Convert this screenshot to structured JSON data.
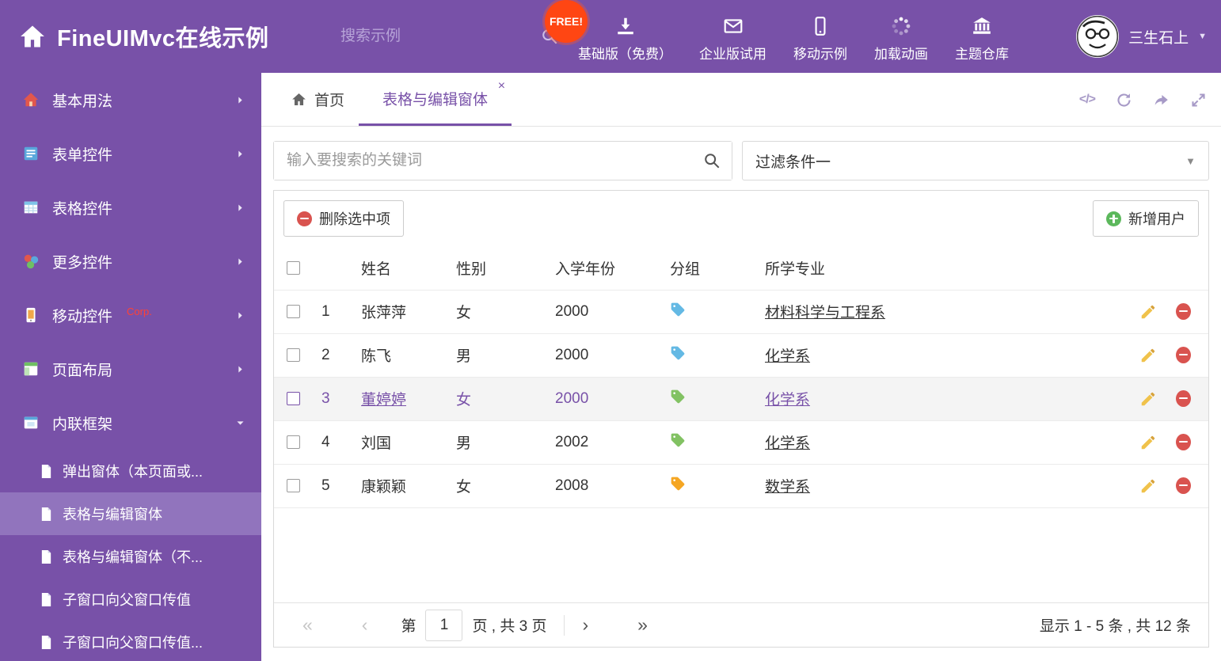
{
  "colors": {
    "primary": "#7851a8",
    "sidebar_active": "#9174bd",
    "free_badge": "#ff4613",
    "danger": "#d9534f",
    "success": "#5cb85c"
  },
  "header": {
    "logo_title": "FineUIMvc在线示例",
    "search_placeholder": "搜索示例",
    "free_badge": "FREE!",
    "nav": [
      {
        "label": "基础版（免费）",
        "icon": "download-icon"
      },
      {
        "label": "企业版试用",
        "icon": "envelope-icon"
      },
      {
        "label": "移动示例",
        "icon": "mobile-icon"
      },
      {
        "label": "加载动画",
        "icon": "spinner-icon"
      },
      {
        "label": "主题仓库",
        "icon": "bank-icon"
      }
    ],
    "user_name": "三生石上",
    "user_caret": "▼"
  },
  "sidebar": {
    "items": [
      {
        "label": "基本用法"
      },
      {
        "label": "表单控件"
      },
      {
        "label": "表格控件"
      },
      {
        "label": "更多控件"
      },
      {
        "label": "移动控件",
        "badge": "Corp."
      },
      {
        "label": "页面布局"
      },
      {
        "label": "内联框架"
      }
    ],
    "subitems": [
      {
        "label": "弹出窗体（本页面或..."
      },
      {
        "label": "表格与编辑窗体"
      },
      {
        "label": "表格与编辑窗体（不..."
      },
      {
        "label": "子窗口向父窗口传值"
      },
      {
        "label": "子窗口向父窗口传值..."
      }
    ]
  },
  "tabs": {
    "home_label": "首页",
    "active_label": "表格与编辑窗体",
    "close_glyph": "×",
    "code_glyph": "</>"
  },
  "filter_bar": {
    "search_placeholder": "输入要搜索的关键词",
    "dropdown_value": "过滤条件一",
    "caret_glyph": "▼"
  },
  "toolbar": {
    "delete_label": "删除选中项",
    "add_label": "新增用户"
  },
  "table": {
    "headers": {
      "name": "姓名",
      "gender": "性别",
      "year": "入学年份",
      "group": "分组",
      "major": "所学专业"
    },
    "rows": [
      {
        "num": "1",
        "name": "张萍萍",
        "gender": "女",
        "year": "2000",
        "tag_color": "#64b9e4",
        "major": "材料科学与工程系",
        "selected": false
      },
      {
        "num": "2",
        "name": "陈飞",
        "gender": "男",
        "year": "2000",
        "tag_color": "#64b9e4",
        "major": "化学系",
        "selected": false
      },
      {
        "num": "3",
        "name": "董婷婷",
        "gender": "女",
        "year": "2000",
        "tag_color": "#82c263",
        "major": "化学系",
        "selected": true
      },
      {
        "num": "4",
        "name": "刘国",
        "gender": "男",
        "year": "2002",
        "tag_color": "#82c263",
        "major": "化学系",
        "selected": false
      },
      {
        "num": "5",
        "name": "康颖颖",
        "gender": "女",
        "year": "2008",
        "tag_color": "#f5a623",
        "major": "数学系",
        "selected": false
      }
    ]
  },
  "pagination": {
    "first_glyph": "«",
    "prev_glyph": "‹",
    "page_prefix": "第",
    "current_page": "1",
    "page_suffix": "页 , 共 3 页",
    "next_glyph": "›",
    "last_glyph": "»",
    "summary": "显示 1 - 5 条 , 共 12 条"
  }
}
